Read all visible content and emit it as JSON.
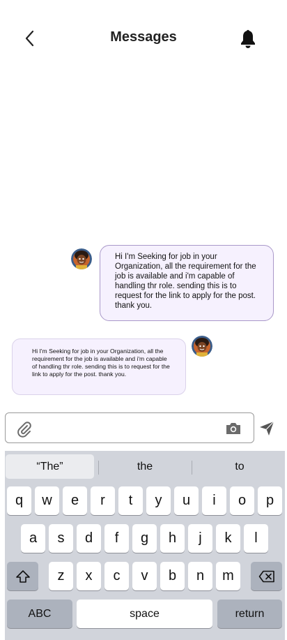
{
  "header": {
    "title": "Messages"
  },
  "messages": [
    {
      "side": "right",
      "text": "Hi I'm Seeking for job in your Organization, all the requirement for the job is available and i'm capable of handling thr role. sending this is to request for the link to apply for the post. thank you."
    },
    {
      "side": "left",
      "text": "Hi I'm Seeking for job in your Organization, all the requirement for the job is available and i'm capable of handling thr role. sending this is to request for the link to apply for the post. thank you."
    }
  ],
  "composer": {
    "value": "",
    "placeholder": ""
  },
  "keyboard": {
    "suggestions": [
      "“The”",
      "the",
      "to"
    ],
    "row1": [
      "q",
      "w",
      "e",
      "r",
      "t",
      "y",
      "u",
      "i",
      "o",
      "p"
    ],
    "row2": [
      "a",
      "s",
      "d",
      "f",
      "g",
      "h",
      "j",
      "k",
      "l"
    ],
    "row3": [
      "z",
      "x",
      "c",
      "v",
      "b",
      "n",
      "m"
    ],
    "abc_label": "ABC",
    "space_label": "space",
    "return_label": "return"
  },
  "colors": {
    "bubble_bg": "#f6f1fe",
    "bubble_border": "#a998c9",
    "keyboard_bg": "#d1d4db",
    "special_key_bg": "#acb2bd"
  },
  "icons": {
    "back": "chevron-left-icon",
    "notifications": "bell-icon",
    "attach": "paperclip-icon",
    "camera": "camera-icon",
    "send": "send-icon",
    "shift": "shift-icon",
    "delete": "backspace-icon"
  }
}
